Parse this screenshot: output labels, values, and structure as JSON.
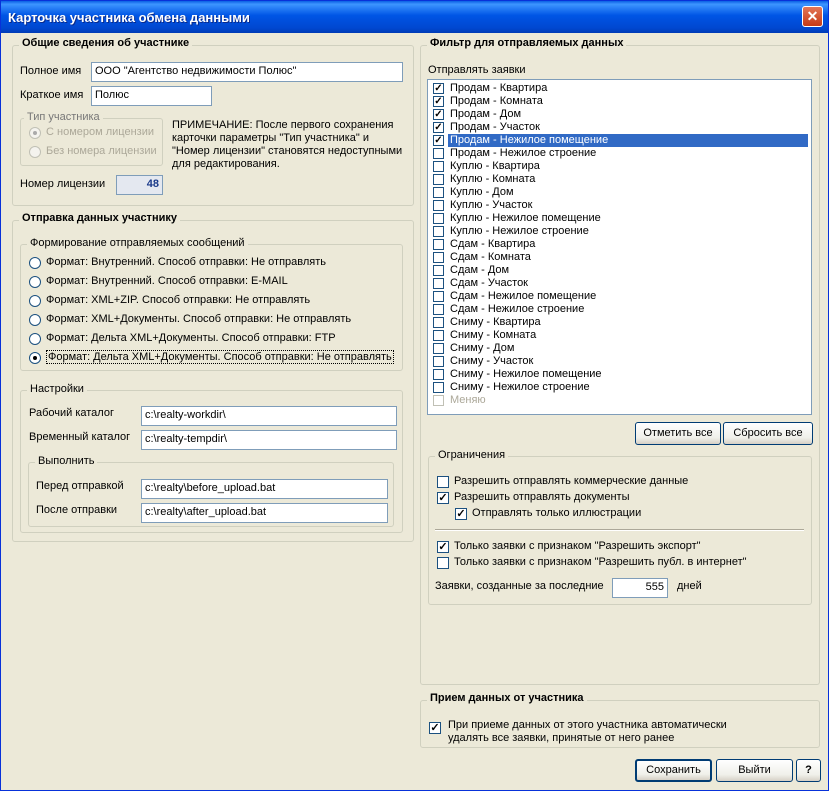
{
  "window": {
    "title": "Карточка участника обмена данными",
    "close_label": "✕"
  },
  "general": {
    "title": "Общие сведения об участнике",
    "full_name_label": "Полное имя",
    "full_name_value": "ООО \"Агентство недвижимости Полюс\"",
    "short_name_label": "Краткое имя",
    "short_name_value": "Полюс",
    "type_title": "Тип участника",
    "type_options": [
      "С номером лицензии",
      "Без номера лицензии"
    ],
    "note": [
      "ПРИМЕЧАНИЕ: После первого сохранения",
      "карточки параметры \"Тип участника\" и",
      "\"Номер лицензии\" становятся недоступными",
      "для редактирования."
    ],
    "license_label": "Номер лицензии",
    "license_value": "48"
  },
  "send": {
    "title": "Отправка данных участнику",
    "format_title": "Формирование отправляемых сообщений",
    "formats": [
      "Формат: Внутренний. Способ отправки: Не отправлять",
      "Формат: Внутренний. Способ отправки: E-MAIL",
      "Формат: XML+ZIP. Способ отправки: Не отправлять",
      "Формат: XML+Документы. Способ отправки: Не отправлять",
      "Формат: Дельта XML+Документы. Способ отправки: FTP",
      "Формат: Дельта XML+Документы. Способ отправки: Не отправлять"
    ],
    "settings_title": "Настройки",
    "workdir_label": "Рабочий каталог",
    "workdir_value": "c:\\realty-workdir\\",
    "tempdir_label": "Временный каталог",
    "tempdir_value": "c:\\realty-tempdir\\",
    "run_title": "Выполнить",
    "before_label": "Перед отправкой",
    "before_value": "c:\\realty\\before_upload.bat",
    "after_label": "После отправки",
    "after_value": "c:\\realty\\after_upload.bat"
  },
  "filter": {
    "title": "Фильтр для отправляемых данных",
    "send_label": "Отправлять заявки",
    "items": [
      {
        "label": "Продам - Квартира",
        "checked": true
      },
      {
        "label": "Продам - Комната",
        "checked": true
      },
      {
        "label": "Продам - Дом",
        "checked": true
      },
      {
        "label": "Продам - Участок",
        "checked": true
      },
      {
        "label": "Продам - Нежилое помещение",
        "checked": true
      },
      {
        "label": "Продам - Нежилое строение",
        "checked": false
      },
      {
        "label": "Куплю - Квартира",
        "checked": false
      },
      {
        "label": "Куплю - Комната",
        "checked": false
      },
      {
        "label": "Куплю - Дом",
        "checked": false
      },
      {
        "label": "Куплю - Участок",
        "checked": false
      },
      {
        "label": "Куплю - Нежилое помещение",
        "checked": false
      },
      {
        "label": "Куплю - Нежилое строение",
        "checked": false
      },
      {
        "label": "Сдам - Квартира",
        "checked": false
      },
      {
        "label": "Сдам - Комната",
        "checked": false
      },
      {
        "label": "Сдам - Дом",
        "checked": false
      },
      {
        "label": "Сдам - Участок",
        "checked": false
      },
      {
        "label": "Сдам - Нежилое помещение",
        "checked": false
      },
      {
        "label": "Сдам - Нежилое строение",
        "checked": false
      },
      {
        "label": "Сниму - Квартира",
        "checked": false
      },
      {
        "label": "Сниму - Комната",
        "checked": false
      },
      {
        "label": "Сниму - Дом",
        "checked": false
      },
      {
        "label": "Сниму - Участок",
        "checked": false
      },
      {
        "label": "Сниму - Нежилое помещение",
        "checked": false
      },
      {
        "label": "Сниму - Нежилое строение",
        "checked": false
      },
      {
        "label": "Меняю",
        "checked": false
      }
    ],
    "mark_all_label": "Отметить все",
    "reset_all_label": "Сбросить все",
    "limits_title": "Ограничения",
    "allow_commercial": "Разрешить отправлять коммерческие данные",
    "allow_docs": "Разрешить отправлять документы",
    "only_illustrations": "Отправлять только иллюстрации",
    "only_export": "Только заявки с признаком \"Разрешить экспорт\"",
    "only_public": "Только заявки с признаком \"Разрешить публ. в интернет\"",
    "days_label": "Заявки, созданные за последние",
    "days_value": "555",
    "days_unit": "дней"
  },
  "receive": {
    "title": "Прием данных от участника",
    "auto_delete": [
      "При приеме данных от этого участника автоматически",
      "удалять все заявки, принятые от него ранее"
    ]
  },
  "footer": {
    "save_label": "Сохранить",
    "exit_label": "Выйти",
    "help_label": "?"
  }
}
